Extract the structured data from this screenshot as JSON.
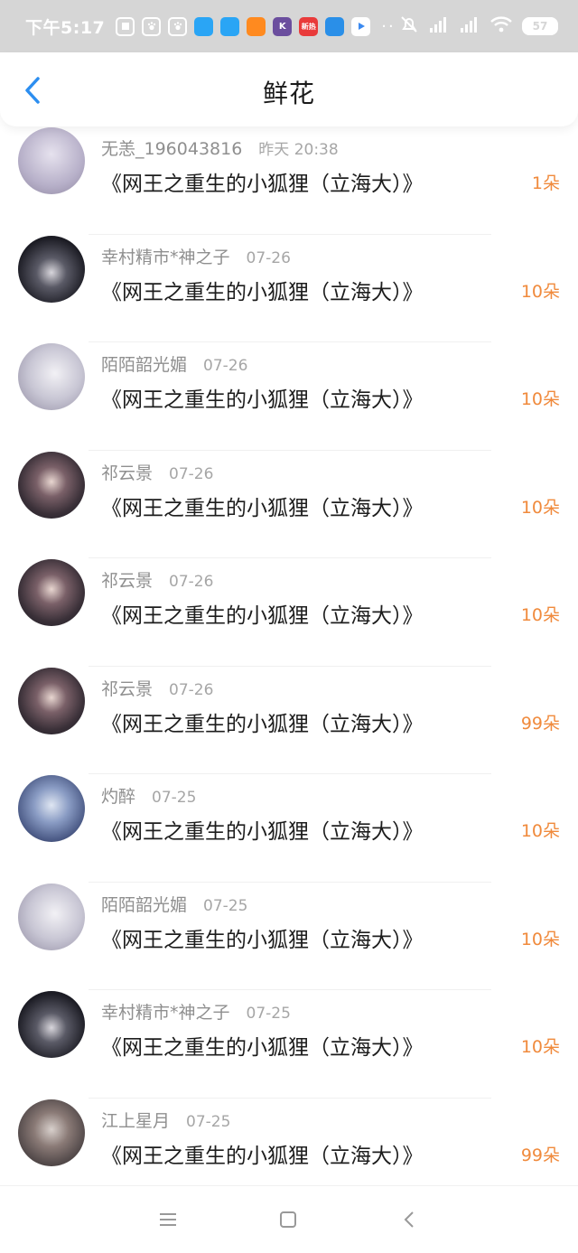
{
  "status_bar": {
    "time": "下午5:17",
    "apps": [
      {
        "icon": "notes-app-icon",
        "color": "#ffffff",
        "label": ""
      },
      {
        "icon": "baidu-paw-icon",
        "color": "#ffffff",
        "label": ""
      },
      {
        "icon": "baidu-paw-icon",
        "color": "#ffffff",
        "label": ""
      },
      {
        "icon": "blue-app-icon",
        "color": "#2aa5f5",
        "label": ""
      },
      {
        "icon": "blue-app-icon",
        "color": "#2aa5f5",
        "label": ""
      },
      {
        "icon": "uc-browser-icon",
        "color": "#ff8a1f",
        "label": ""
      },
      {
        "icon": "k-app-icon",
        "color": "#6b4e9e",
        "label": "K"
      },
      {
        "icon": "news-app-icon",
        "color": "#e93b3b",
        "label": "新热"
      },
      {
        "icon": "car-app-icon",
        "color": "#2a8fe8",
        "label": ""
      },
      {
        "icon": "video-app-icon",
        "color": "#ffffff",
        "label": ""
      }
    ],
    "dots": "··",
    "battery": "57"
  },
  "header": {
    "title": "鲜花"
  },
  "records": [
    {
      "user": "无恙_196043816",
      "date": "昨天 20:38",
      "book": "《网王之重生的小狐狸（立海大）》",
      "amount": "1朵",
      "avatar_color": "#b7b0c9"
    },
    {
      "user": "幸村精市*神之子",
      "date": "07-26",
      "book": "《网王之重生的小狐狸（立海大）》",
      "amount": "10朵",
      "avatar_color": "#1c1c24"
    },
    {
      "user": "陌陌韶光媚",
      "date": "07-26",
      "book": "《网王之重生的小狐狸（立海大）》",
      "amount": "10朵",
      "avatar_color": "#c8c6d4"
    },
    {
      "user": "祁云景",
      "date": "07-26",
      "book": "《网王之重生的小狐狸（立海大）》",
      "amount": "10朵",
      "avatar_color": "#3a3038"
    },
    {
      "user": "祁云景",
      "date": "07-26",
      "book": "《网王之重生的小狐狸（立海大）》",
      "amount": "10朵",
      "avatar_color": "#3a3038"
    },
    {
      "user": "祁云景",
      "date": "07-26",
      "book": "《网王之重生的小狐狸（立海大）》",
      "amount": "99朵",
      "avatar_color": "#3a3038"
    },
    {
      "user": "灼醉",
      "date": "07-25",
      "book": "《网王之重生的小狐狸（立海大）》",
      "amount": "10朵",
      "avatar_color": "#4b5a86"
    },
    {
      "user": "陌陌韶光媚",
      "date": "07-25",
      "book": "《网王之重生的小狐狸（立海大）》",
      "amount": "10朵",
      "avatar_color": "#c8c6d4"
    },
    {
      "user": "幸村精市*神之子",
      "date": "07-25",
      "book": "《网王之重生的小狐狸（立海大）》",
      "amount": "10朵",
      "avatar_color": "#1c1c24"
    },
    {
      "user": "江上星月",
      "date": "07-25",
      "book": "《网王之重生的小狐狸（立海大）》",
      "amount": "99朵",
      "avatar_color": "#5a5050"
    }
  ],
  "nav": {
    "menu_icon": "menu-icon",
    "home_icon": "home-square-icon",
    "back_icon": "back-triangle-icon"
  },
  "colors": {
    "accent": "#2c8ef0",
    "amount": "#f08a3c",
    "status_bar": "#d6d6d6"
  }
}
